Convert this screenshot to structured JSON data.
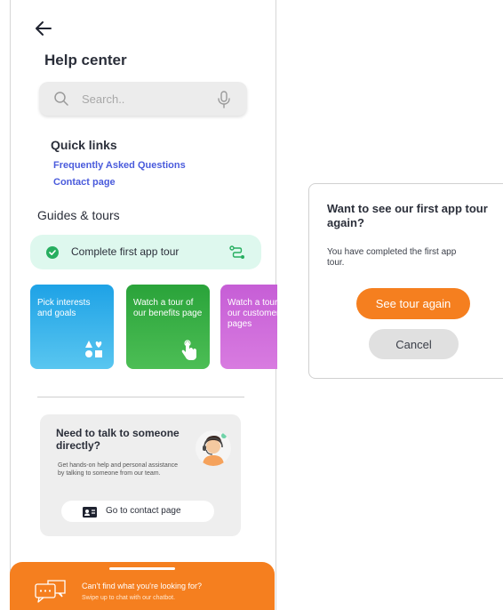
{
  "header": {
    "back_icon": "arrow-left-icon",
    "title": "Help center"
  },
  "search": {
    "placeholder": "Search..",
    "value": "",
    "icon": "search-icon",
    "mic_icon": "microphone-icon"
  },
  "quick_links": {
    "title": "Quick links",
    "links": [
      {
        "label": "Frequently Asked Questions"
      },
      {
        "label": "Contact page"
      }
    ],
    "link_color": "#4a5bdc"
  },
  "guides": {
    "title": "Guides & tours",
    "completed_tour": {
      "label": "Complete first app tour",
      "status_icon": "check-circle-icon",
      "action_icon": "route-icon",
      "color": "#def8ee"
    },
    "cards": [
      {
        "label": "Pick interests and goals",
        "icon": "shapes-icon",
        "color": "#1ea2e6"
      },
      {
        "label": "Watch a tour of our benefits page",
        "icon": "tap-hand-icon",
        "color": "#2aa33a"
      },
      {
        "label": "Watch a tour of our customer pages",
        "icon": "",
        "color": "#c65ed6"
      }
    ]
  },
  "talk": {
    "title": "Need to talk to someone directly?",
    "description": "Get hands-on help and personal assistance by talking to someone from our team.",
    "avatar": "support-agent-avatar",
    "button_label": "Go to contact page",
    "button_icon": "contact-card-icon"
  },
  "chatbar": {
    "title": "Can't find what you're looking for?",
    "subtitle": "Swipe up to chat with our chatbot.",
    "icon": "chat-bubbles-icon",
    "color": "#f57f1f"
  },
  "dialog": {
    "title": "Want to see our first app tour again?",
    "body": "You have completed the first app tour.",
    "primary_label": "See tour again",
    "secondary_label": "Cancel",
    "accent": "#f57f1f"
  }
}
